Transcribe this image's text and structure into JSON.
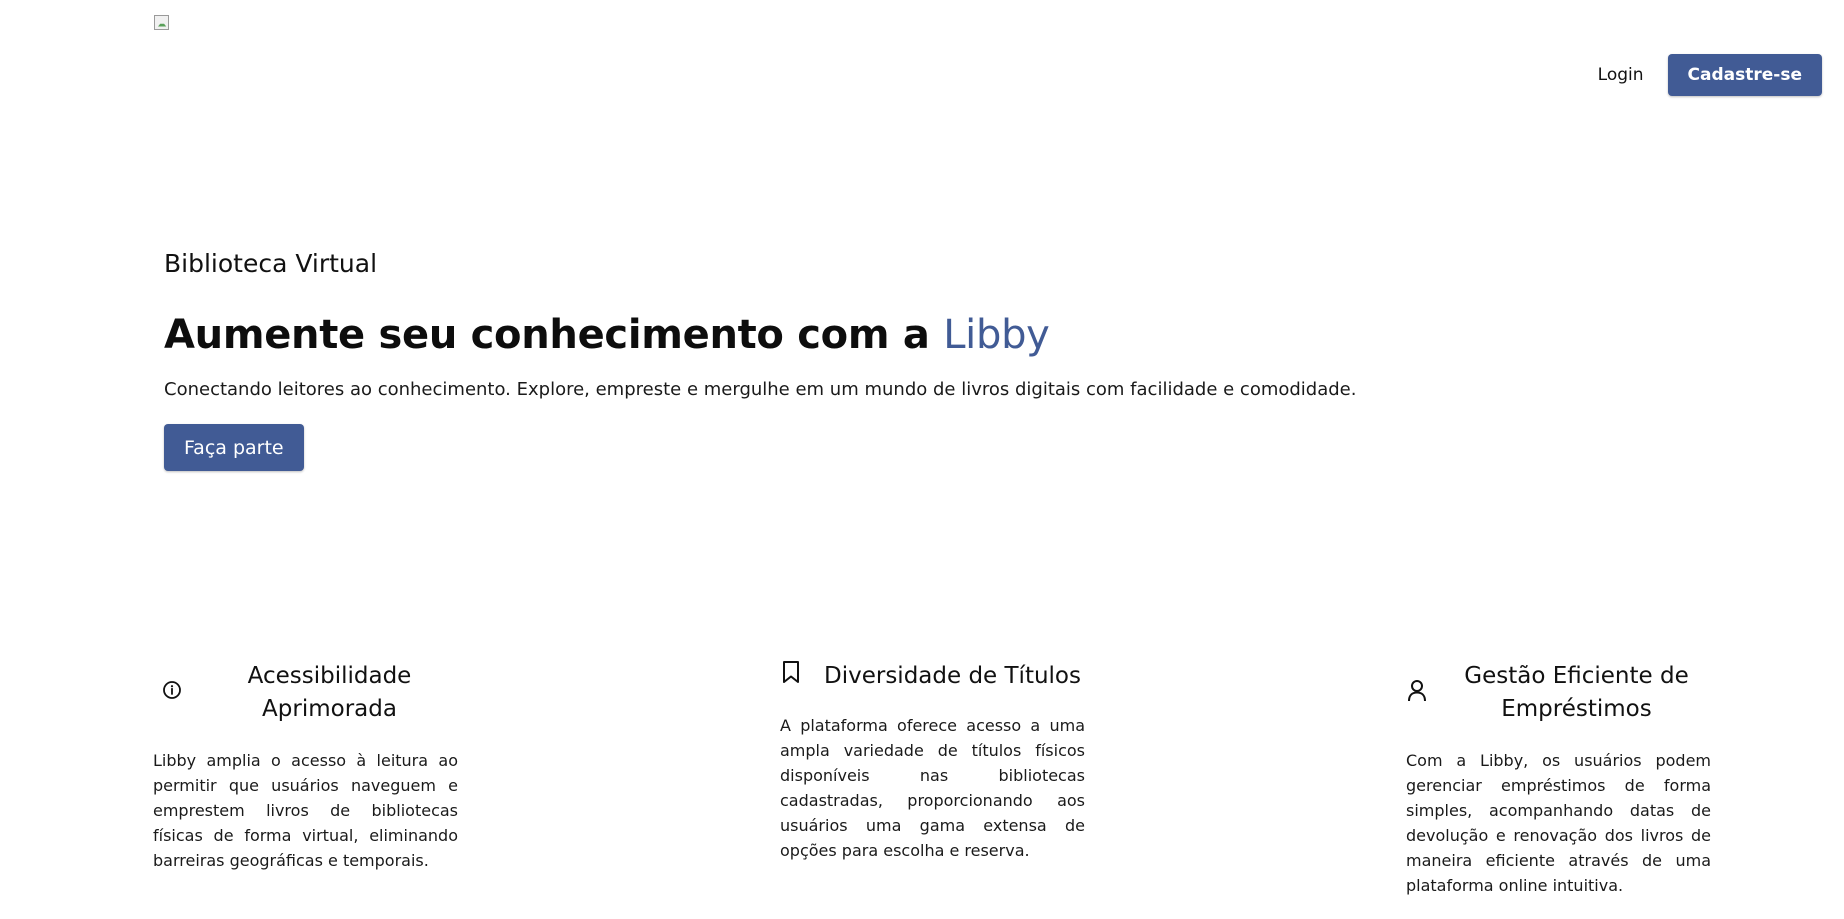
{
  "header": {
    "login_label": "Login",
    "signup_label": "Cadastre-se"
  },
  "hero": {
    "eyebrow": "Biblioteca Virtual",
    "title_prefix": "Aumente seu conhecimento com a",
    "title_brand": "Libby",
    "subtitle": "Conectando leitores ao conhecimento. Explore, empreste e mergulhe em um mundo de livros digitais com facilidade e comodidade.",
    "cta_label": "Faça parte"
  },
  "features": [
    {
      "icon": "info-icon",
      "title": "Acessibilidade Aprimorada",
      "text": "Libby amplia o acesso à leitura ao permitir que usuários naveguem e emprestem livros de bibliotecas físicas de forma virtual, eliminando barreiras geográficas e temporais."
    },
    {
      "icon": "bookmark-icon",
      "title": "Diversidade de Títulos",
      "text": "A plataforma oferece acesso a uma ampla variedade de títulos físicos disponíveis nas bibliotecas cadastradas, proporcionando aos usuários uma gama extensa de opções para escolha e reserva."
    },
    {
      "icon": "user-icon",
      "title": "Gestão Eficiente de Empréstimos",
      "text": "Com a Libby, os usuários podem gerenciar empréstimos de forma simples, acompanhando datas de devolução e renovação dos livros de maneira eficiente através de uma plataforma online intuitiva."
    }
  ],
  "colors": {
    "primary": "#415b95",
    "text": "#000000",
    "background": "#ffffff"
  }
}
